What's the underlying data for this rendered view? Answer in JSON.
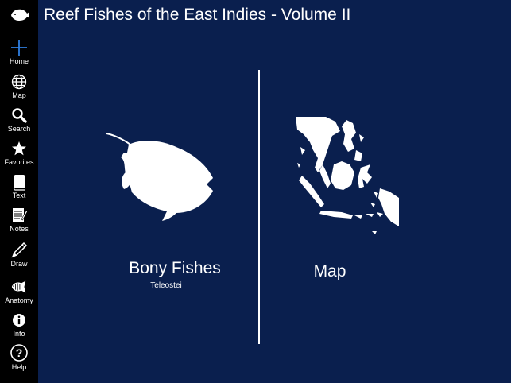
{
  "header": {
    "title": "Reef Fishes of the East Indies - Volume II"
  },
  "sidebar": {
    "items": [
      {
        "label": "Home",
        "icon": "plus-icon"
      },
      {
        "label": "Map",
        "icon": "globe-icon"
      },
      {
        "label": "Search",
        "icon": "magnifier-icon"
      },
      {
        "label": "Favorites",
        "icon": "star-icon"
      },
      {
        "label": "Text",
        "icon": "book-icon"
      },
      {
        "label": "Notes",
        "icon": "notepad-icon"
      },
      {
        "label": "Draw",
        "icon": "pencil-icon"
      },
      {
        "label": "Anatomy",
        "icon": "fish-anatomy-icon"
      },
      {
        "label": "Info",
        "icon": "info-icon"
      },
      {
        "label": "Help",
        "icon": "help-icon"
      }
    ]
  },
  "main": {
    "left_panel": {
      "title": "Bony Fishes",
      "subtitle": "Teleostei"
    },
    "right_panel": {
      "title": "Map"
    }
  },
  "colors": {
    "background": "#0a1f4e",
    "sidebar": "#000000",
    "accent": "#2f7fe0",
    "text": "#ffffff"
  }
}
